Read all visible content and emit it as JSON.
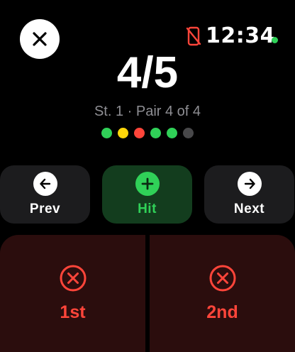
{
  "status": {
    "time": "12:34"
  },
  "score": {
    "value": "4/5"
  },
  "subtitle": "St. 1 · Pair 4 of 4",
  "shots": [
    {
      "color": "#30d158"
    },
    {
      "color": "#ffd60a"
    },
    {
      "color": "#ff453a"
    },
    {
      "color": "#30d158"
    },
    {
      "color": "#30d158"
    },
    {
      "color": "#48484a"
    }
  ],
  "actions": {
    "prev_label": "Prev",
    "hit_label": "Hit",
    "next_label": "Next"
  },
  "miss": {
    "first_label": "1st",
    "second_label": "2nd"
  },
  "colors": {
    "hit_accent": "#30d158",
    "miss_accent": "#ff453a"
  },
  "icons": {
    "close": "close-icon",
    "status": "phone-slash-icon",
    "prev": "arrow-left-icon",
    "hit": "plus-icon",
    "next": "arrow-right-icon",
    "miss": "x-circle-icon"
  }
}
